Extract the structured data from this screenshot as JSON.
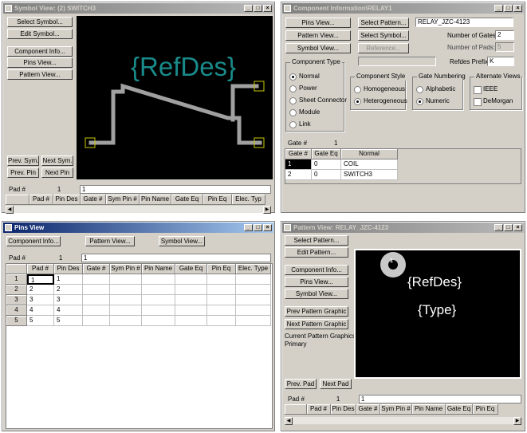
{
  "symbol_window": {
    "title": "Symbol View: (2) SWITCH3",
    "buttons": {
      "select_symbol": "Select Symbol...",
      "edit_symbol": "Edit Symbol...",
      "component_info": "Component Info...",
      "pins_view": "Pins View...",
      "pattern_view": "Pattern View...",
      "prev_sym": "Prev. Sym.",
      "next_sym": "Next Sym.",
      "prev_pin": "Prev. Pin",
      "next_pin": "Next Pin"
    },
    "refdes": "{RefDes}",
    "pad_label": "Pad #",
    "pad_num": "1",
    "pad_value": "1",
    "columns": [
      "Pad #",
      "Pin Des",
      "Gate #",
      "Sym Pin #",
      "Pin Name",
      "Gate Eq",
      "Pin Eq",
      "Elec. Typ"
    ]
  },
  "component_window": {
    "title": "Component Information\\RELAY1",
    "buttons": {
      "pins_view": "Pins View...",
      "pattern_view": "Pattern View...",
      "symbol_view": "Symbol View...",
      "select_pattern": "Select Pattern...",
      "select_symbol": "Select Symbol...",
      "reference": "Reference..."
    },
    "pattern_name": "RELAY_JZC-4123",
    "num_gates_label": "Number of Gates:",
    "num_gates": "2",
    "num_pads_label": "Number of Pads:",
    "num_pads": "5",
    "refdes_prefix_label": "Refdes Prefix:",
    "refdes_prefix": "K",
    "component_type": {
      "title": "Component Type",
      "options": [
        "Normal",
        "Power",
        "Sheet Connector",
        "Module",
        "Link"
      ],
      "selected": "Normal"
    },
    "component_style": {
      "title": "Component Style",
      "options": [
        "Homogeneous",
        "Heterogeneous"
      ],
      "selected": "Heterogeneous"
    },
    "gate_numbering": {
      "title": "Gate Numbering",
      "options": [
        "Alphabetic",
        "Numeric"
      ],
      "selected": "Numeric"
    },
    "alternate_views": {
      "title": "Alternate Views",
      "options": [
        "IEEE",
        "DeMorgan"
      ]
    },
    "gate_label": "Gate #",
    "gate_num": "1",
    "gate_columns": [
      "Gate #",
      "Gate Eq",
      "Normal"
    ],
    "gate_rows": [
      {
        "gate": "1",
        "eq": "0",
        "normal": "COIL"
      },
      {
        "gate": "2",
        "eq": "0",
        "normal": "SWITCH3"
      }
    ]
  },
  "pins_window": {
    "title": "Pins View",
    "buttons": {
      "component_info": "Component Info...",
      "pattern_view": "Pattern View...",
      "symbol_view": "Symbol View..."
    },
    "pad_label": "Pad #",
    "pad_num": "1",
    "pad_value": "1",
    "columns": [
      "Pad #",
      "Pin Des",
      "Gate #",
      "Sym Pin #",
      "Pin Name",
      "Gate Eq",
      "Pin Eq",
      "Elec. Type"
    ],
    "rows": [
      {
        "row": "1",
        "pad": "1",
        "des": "1"
      },
      {
        "row": "2",
        "pad": "2",
        "des": "2"
      },
      {
        "row": "3",
        "pad": "3",
        "des": "3"
      },
      {
        "row": "4",
        "pad": "4",
        "des": "4"
      },
      {
        "row": "5",
        "pad": "5",
        "des": "5"
      }
    ]
  },
  "pattern_window": {
    "title": "Pattern View: RELAY_JZC-4123",
    "buttons": {
      "select_pattern": "Select Pattern...",
      "edit_pattern": "Edit Pattern...",
      "component_info": "Component Info...",
      "pins_view": "Pins View...",
      "symbol_view": "Symbol View...",
      "prev_graphic": "Prev Pattern Graphic",
      "next_graphic": "Next Pattern Graphic",
      "prev_pad": "Prev. Pad",
      "next_pad": "Next Pad"
    },
    "current_graphic_label": "Current Pattern Graphics:",
    "current_graphic": "Primary",
    "pad_marker": "1",
    "refdes": "{RefDes}",
    "type": "{Type}",
    "pad_label": "Pad #",
    "pad_num": "1",
    "pad_value": "1",
    "columns": [
      "Pad #",
      "Pin Des",
      "Gate #",
      "Sym Pin #",
      "Pin Name",
      "Gate Eq",
      "Pin Eq"
    ]
  },
  "colors": {
    "refdes_teal": "#1a8a8a",
    "symbol_gray": "#a0a0a0",
    "active_title": "#0a246a"
  }
}
